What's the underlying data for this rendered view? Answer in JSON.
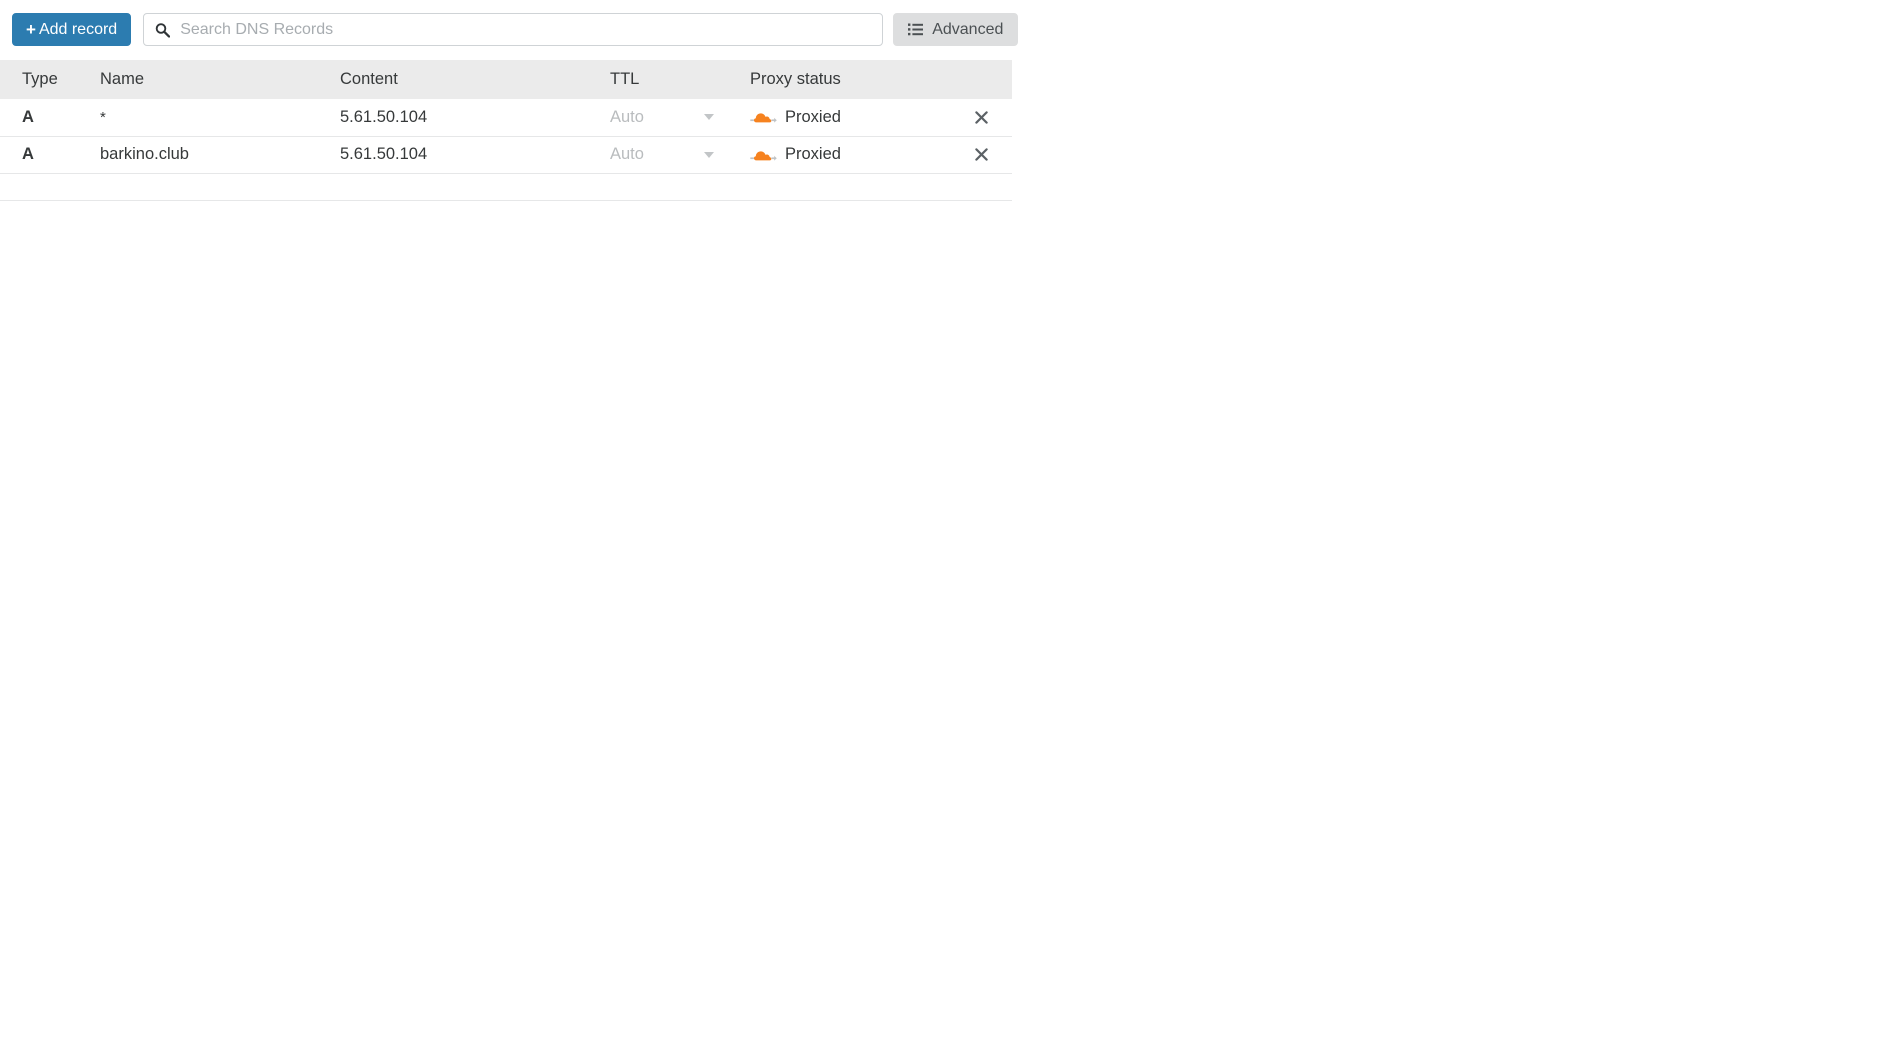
{
  "toolbar": {
    "add_record_label": "Add record",
    "add_record_plus": "+",
    "search_placeholder": "Search DNS Records",
    "search_value": "",
    "search_icon": "search-icon",
    "advanced_label": "Advanced",
    "advanced_icon": "list-lines-icon"
  },
  "table": {
    "columns": [
      {
        "key": "type",
        "label": "Type"
      },
      {
        "key": "name",
        "label": "Name"
      },
      {
        "key": "content",
        "label": "Content"
      },
      {
        "key": "ttl",
        "label": "TTL"
      },
      {
        "key": "proxy",
        "label": "Proxy status"
      }
    ],
    "rows": [
      {
        "type": "A",
        "name": "*",
        "content": "5.61.50.104",
        "ttl": "Auto",
        "proxy_status": "Proxied",
        "proxy_icon": "cloudflare-cloud-icon",
        "delete_icon": "close-icon"
      },
      {
        "type": "A",
        "name": "barkino.club",
        "content": "5.61.50.104",
        "ttl": "Auto",
        "proxy_status": "Proxied",
        "proxy_icon": "cloudflare-cloud-icon",
        "delete_icon": "close-icon"
      }
    ]
  },
  "colors": {
    "primary_button": "#2c7cb0",
    "advanced_button": "#dddedf",
    "header_row": "#ebebeb",
    "proxied_orange": "#f6821f",
    "text": "#36393a",
    "muted_text": "#b9bcbe",
    "border": "#e6e7e8"
  }
}
